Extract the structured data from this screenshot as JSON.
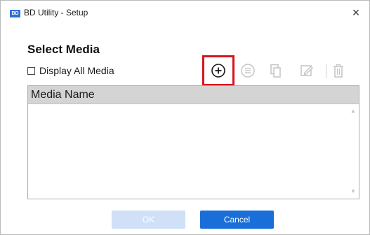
{
  "window": {
    "title": "BD Utility - Setup",
    "app_icon_text": "BD",
    "close_glyph": "×"
  },
  "heading": "Select Media",
  "display_all": {
    "label": "Display All Media",
    "checked": false
  },
  "toolbar": {
    "icons": [
      {
        "name": "add-media-icon",
        "enabled": true,
        "highlighted": true
      },
      {
        "name": "list-details-icon",
        "enabled": false
      },
      {
        "name": "copy-icon",
        "enabled": false
      },
      {
        "name": "edit-icon",
        "enabled": false
      },
      {
        "name": "delete-icon",
        "enabled": false
      }
    ]
  },
  "list": {
    "column_header": "Media Name",
    "rows": []
  },
  "buttons": {
    "ok": "OK",
    "cancel": "Cancel"
  },
  "colors": {
    "highlight": "#d6141e",
    "primary_button": "#1a6ed8",
    "disabled_button": "#cfe0f7",
    "disabled_icon": "#c4c4c4"
  }
}
